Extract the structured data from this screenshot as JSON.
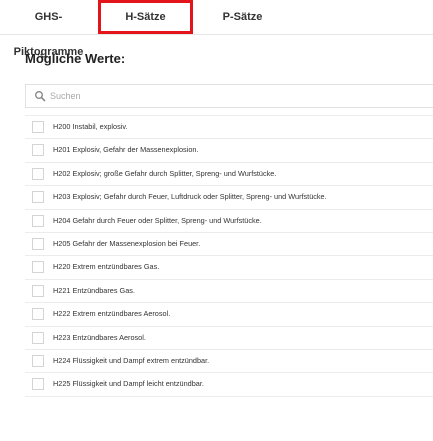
{
  "tabs": [
    {
      "label": "GHS-Piktogramme"
    },
    {
      "label": "H-Sätze"
    },
    {
      "label": "P-Sätze"
    }
  ],
  "section": {
    "title": "Mögliche Werte:"
  },
  "search": {
    "placeholder": "Suchen",
    "value": ""
  },
  "items": [
    {
      "label": "H200 Instabil, explosiv."
    },
    {
      "label": "H201 Explosiv, Gefahr der Massenexplosion."
    },
    {
      "label": "H202 Explosiv; große Gefahr durch Splitter, Spreng- und Wurfstücke."
    },
    {
      "label": "H203 Explosiv; Gefahr durch Feuer, Luftdruck oder Splitter, Spreng- und Wurfstücke."
    },
    {
      "label": "H204 Gefahr durch Feuer oder Splitter, Spreng- und Wurfstücke."
    },
    {
      "label": "H205 Gefahr der Massenexplosion bei Feuer."
    },
    {
      "label": "H220 Extrem entzündbares Gas."
    },
    {
      "label": "H221 Entzündbares Gas."
    },
    {
      "label": "H222 Extrem entzündbares Aerosol."
    },
    {
      "label": "H223 Entzündbares Aerosol."
    },
    {
      "label": "H224 Flüssigkeit und Dampf extrem entzündbar."
    },
    {
      "label": "H225 Flüssigkeit und Dampf leicht entzündbar."
    }
  ],
  "colors": {
    "active_tab_border": "#e3151b",
    "text": "#333333",
    "placeholder": "#a9a9a9"
  },
  "icons": {
    "search": "search-icon"
  }
}
